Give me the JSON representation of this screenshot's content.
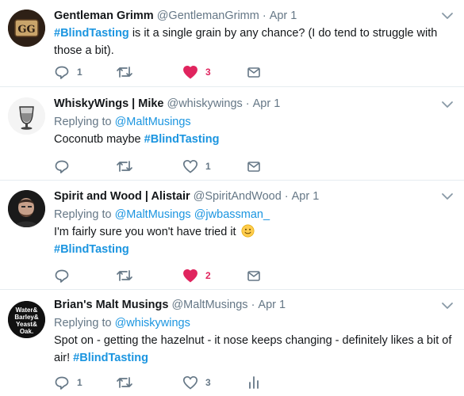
{
  "tweets": [
    {
      "name": "Gentleman Grimm",
      "handle": "@GentlemanGrimm",
      "separator": "·",
      "time": "Apr 1",
      "avatar_text": "GG",
      "hashtag": "#BlindTasting",
      "text": " is it a single grain by any chance? (I do tend to struggle with those a bit).",
      "reply_count": "1",
      "retweet_count": "",
      "like_count": "3",
      "liked": true
    },
    {
      "name": "WhiskyWings | Mike",
      "handle": "@whiskywings",
      "separator": "·",
      "time": "Apr 1",
      "replying_label": "Replying to ",
      "replying_to": "@MaltMusings",
      "text": "Coconutb maybe ",
      "hashtag": "#BlindTasting",
      "reply_count": "",
      "retweet_count": "",
      "like_count": "1",
      "liked": false
    },
    {
      "name": "Spirit and Wood | Alistair",
      "handle": "@SpiritAndWood",
      "separator": "·",
      "time": "Apr 1",
      "replying_label": "Replying to ",
      "replying_to": "@MaltMusings @jwbassman_",
      "text": "I'm fairly sure you won't have tried it ",
      "hashtag": "#BlindTasting",
      "reply_count": "",
      "retweet_count": "",
      "like_count": "2",
      "liked": true
    },
    {
      "name": "Brian's Malt Musings",
      "handle": "@MaltMusings",
      "separator": "·",
      "time": "Apr 1",
      "avatar_text": "Water& Barley& Yeast& Oak.",
      "replying_label": "Replying to ",
      "replying_to": "@whiskywings",
      "text": "Spot on - getting the hazelnut - it nose keeps changing - definitely likes a bit of air! ",
      "hashtag": "#BlindTasting",
      "reply_count": "1",
      "retweet_count": "",
      "like_count": "3",
      "liked": false
    }
  ],
  "colors": {
    "link": "#1b95e0",
    "muted": "#657786",
    "like_active": "#e0245e",
    "divider": "#e6ecf0"
  },
  "icons": [
    "reply-icon",
    "retweet-icon",
    "like-icon",
    "message-icon",
    "analytics-icon",
    "chevron-down-icon",
    "smiley-emoji-icon"
  ]
}
